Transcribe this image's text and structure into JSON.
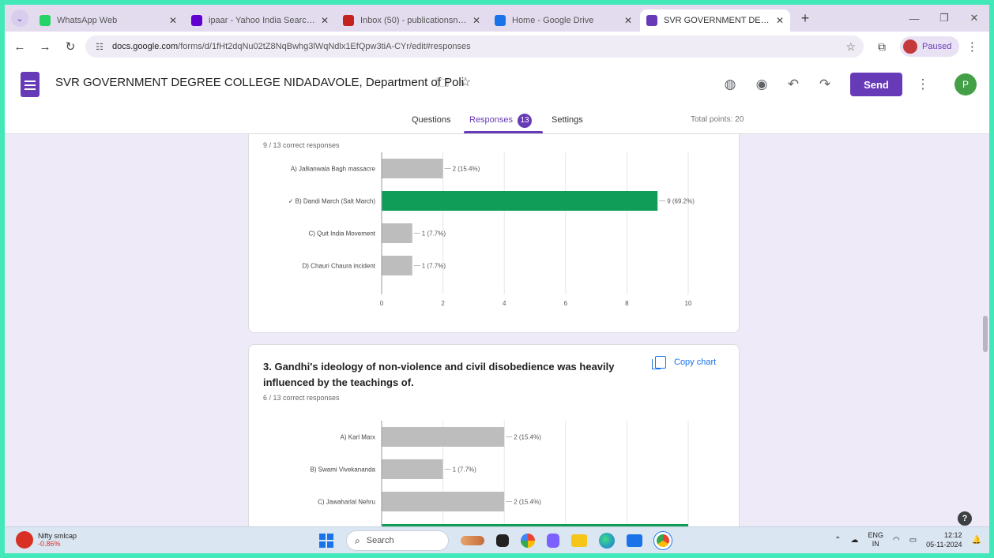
{
  "browser": {
    "tabs": [
      {
        "title": "WhatsApp Web",
        "color": "#25d366",
        "active": false
      },
      {
        "title": "ipaar - Yahoo India Search Re",
        "color": "#6001d2",
        "active": false
      },
      {
        "title": "Inbox (50) - publicationsnmn",
        "color": "#c5221f",
        "active": false
      },
      {
        "title": "Home - Google Drive",
        "color": "#1a73e8",
        "active": false
      },
      {
        "title": "SVR GOVERNMENT DEGREE C",
        "color": "#673ab7",
        "active": true
      }
    ],
    "url_host": "docs.google.com",
    "url_path": "/forms/d/1fHt2dqNu02tZ8NqBwhg3lWqNdlx1EfQpw3tiA-CYr/edit#responses",
    "profile_label": "Paused"
  },
  "header": {
    "title": "SVR GOVERNMENT DEGREE COLLEGE NIDADAVOLE, Department of Poli",
    "send_label": "Send",
    "avatar_letter": "P",
    "tabs": {
      "questions": "Questions",
      "responses": "Responses",
      "settings": "Settings"
    },
    "responses_count": "13",
    "total_points": "Total points: 20"
  },
  "card1": {
    "subtitle": "9 / 13 correct responses"
  },
  "card2": {
    "title": "3. Gandhi's ideology of non-violence and civil disobedience was heavily influenced by the teachings of.",
    "subtitle": "6 / 13 correct responses",
    "copy_label": "Copy chart"
  },
  "chart_data": [
    {
      "type": "bar",
      "orientation": "horizontal",
      "categories": [
        "A) Jallianwala Bagh massacre",
        "✓ B) Dandi March (Salt March)",
        "C) Quit India Movement",
        "D) Chauri Chaura incident"
      ],
      "values": [
        2,
        9,
        1,
        1
      ],
      "labels": [
        "2 (15.4%)",
        "9 (69.2%)",
        "1 (7.7%)",
        "1 (7.7%)"
      ],
      "correct_index": 1,
      "xlim": [
        0,
        10
      ],
      "xticks": [
        "0",
        "2",
        "4",
        "6",
        "8",
        "10"
      ],
      "colors": {
        "default": "#bdbdbd",
        "correct": "#0f9d58"
      }
    },
    {
      "type": "bar",
      "orientation": "horizontal",
      "categories": [
        "A) Karl Marx",
        "B) Swami Vivekananda",
        "C) Jawaharlal Nehru",
        ""
      ],
      "values": [
        2,
        1,
        2,
        5
      ],
      "labels": [
        "2 (15.4%)",
        "1 (7.7%)",
        "2 (15.4%)",
        ""
      ],
      "correct_index": 3,
      "xlim": [
        0,
        5
      ],
      "colors": {
        "default": "#bdbdbd",
        "correct": "#0f9d58"
      }
    }
  ],
  "taskbar": {
    "weather_title": "Nifty smlcap",
    "weather_value": "-0.86%",
    "search_placeholder": "Search",
    "lang_top": "ENG",
    "lang_bottom": "IN",
    "time": "12:12",
    "date": "05-11-2024"
  }
}
